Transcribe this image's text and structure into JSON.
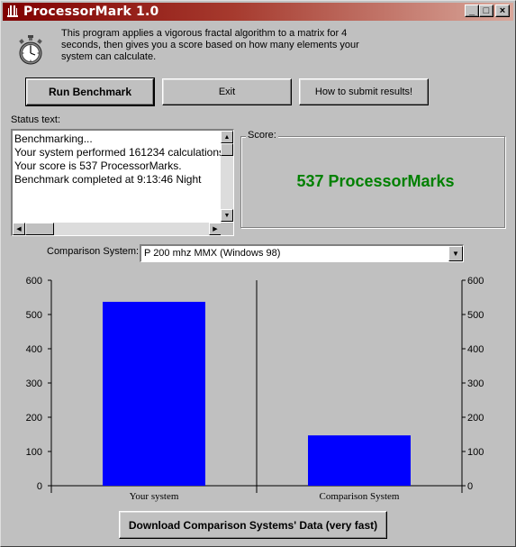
{
  "window": {
    "title": "ProcessorMark 1.0"
  },
  "title_buttons": {
    "minimize": "_",
    "maximize": "□",
    "close": "×"
  },
  "description": "This program applies a vigorous fractal algorithm to a matrix for 4 seconds, then gives you a score based on how many elements your system can calculate.",
  "buttons": {
    "run": "Run Benchmark",
    "exit": "Exit",
    "submit": "How to submit results!",
    "download": "Download Comparison Systems' Data (very fast)"
  },
  "status": {
    "label": "Status text:",
    "lines": [
      "Benchmarking...",
      "Your system performed 161234 calculations",
      "Your score is 537 ProcessorMarks.",
      "Benchmark completed at 9:13:46 Night"
    ]
  },
  "score": {
    "label": "Score:",
    "value": "537 ProcessorMarks",
    "color": "#008000"
  },
  "comparison": {
    "label": "Comparison System:",
    "selected": "P 200 mhz MMX (Windows 98)"
  },
  "icons": {
    "app": "stopwatch-icon",
    "about": "stopwatch-icon"
  },
  "chart_data": {
    "type": "bar",
    "categories": [
      "Your system",
      "Comparison System"
    ],
    "values": [
      537,
      147
    ],
    "ylim": [
      0,
      600
    ],
    "yticks": [
      0,
      100,
      200,
      300,
      400,
      500,
      600
    ],
    "bar_color": "#0000ff",
    "grid": true
  }
}
